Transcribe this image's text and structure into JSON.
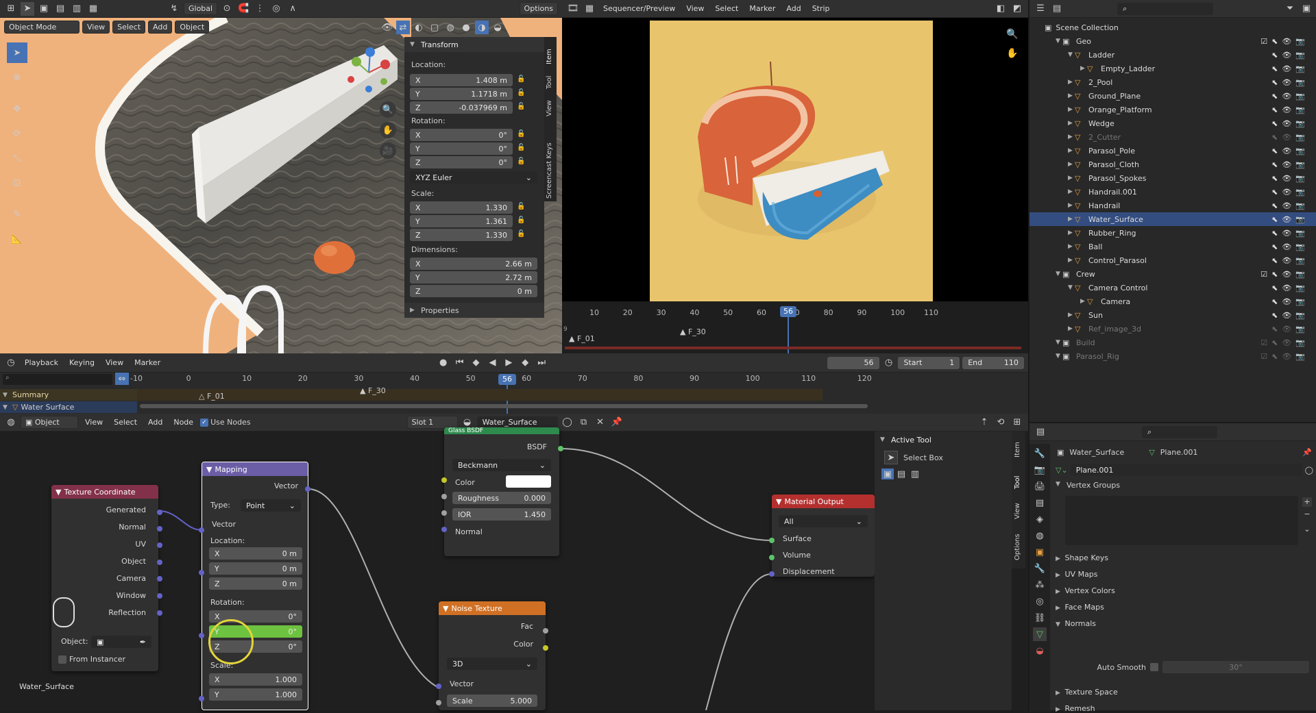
{
  "viewport": {
    "header": {
      "mode": "Object Mode",
      "menus": [
        "View",
        "Select",
        "Add",
        "Object"
      ],
      "orientation": "Global",
      "options": "Options"
    },
    "side_tabs": [
      "Item",
      "Tool",
      "View",
      "Screencast Keys"
    ],
    "transform": {
      "title": "Transform",
      "location_label": "Location:",
      "location": [
        {
          "axis": "X",
          "value": "1.408 m"
        },
        {
          "axis": "Y",
          "value": "1.1718 m"
        },
        {
          "axis": "Z",
          "value": "-0.037969 m"
        }
      ],
      "rotation_label": "Rotation:",
      "rotation": [
        {
          "axis": "X",
          "value": "0°"
        },
        {
          "axis": "Y",
          "value": "0°"
        },
        {
          "axis": "Z",
          "value": "0°"
        }
      ],
      "rotation_mode": "XYZ Euler",
      "scale_label": "Scale:",
      "scale": [
        {
          "axis": "X",
          "value": "1.330"
        },
        {
          "axis": "Y",
          "value": "1.361"
        },
        {
          "axis": "Z",
          "value": "1.330"
        }
      ],
      "dimensions_label": "Dimensions:",
      "dimensions": [
        {
          "axis": "X",
          "value": "2.66 m"
        },
        {
          "axis": "Y",
          "value": "2.72 m"
        },
        {
          "axis": "Z",
          "value": "0 m"
        }
      ],
      "properties": "Properties"
    }
  },
  "sequencer": {
    "header": {
      "mode": "Sequencer/Preview",
      "menus": [
        "View",
        "Select",
        "Marker",
        "Add",
        "Strip"
      ]
    },
    "ruler": [
      "10",
      "20",
      "30",
      "40",
      "50",
      "60",
      "70",
      "80",
      "90",
      "100",
      "110"
    ],
    "current_frame": "56",
    "markers": [
      "F_01",
      "F_30"
    ],
    "channel_num": "9"
  },
  "timeline": {
    "menus": [
      "Playback",
      "Keying",
      "View",
      "Marker"
    ],
    "frame": "56",
    "start_label": "Start",
    "start": "1",
    "end_label": "End",
    "end": "110",
    "ruler": [
      "-10",
      "0",
      "10",
      "20",
      "30",
      "40",
      "50",
      "60",
      "70",
      "80",
      "90",
      "100",
      "110",
      "120"
    ],
    "current_frame": "56",
    "summary": "Summary",
    "water_surface": "Water Surface",
    "markers": [
      "F_01",
      "F_30"
    ]
  },
  "node_editor": {
    "header": {
      "object": "Object",
      "menus": [
        "View",
        "Select",
        "Add",
        "Node"
      ],
      "use_nodes": "Use Nodes",
      "slot": "Slot 1",
      "material": "Water_Surface"
    },
    "footer_label": "Water_Surface",
    "tex_coord": {
      "title": "Texture Coordinate",
      "outputs": [
        "Generated",
        "Normal",
        "UV",
        "Object",
        "Camera",
        "Window",
        "Reflection"
      ],
      "object_label": "Object:",
      "from_instancer": "From Instancer"
    },
    "mapping": {
      "title": "Mapping",
      "vector_out": "Vector",
      "type_label": "Type:",
      "type": "Point",
      "vector_in": "Vector",
      "location_label": "Location:",
      "location": [
        {
          "axis": "X",
          "value": "0 m"
        },
        {
          "axis": "Y",
          "value": "0 m"
        },
        {
          "axis": "Z",
          "value": "0 m"
        }
      ],
      "rotation_label": "Rotation:",
      "rotation": [
        {
          "axis": "X",
          "value": "0°"
        },
        {
          "axis": "Y",
          "value": "0°"
        },
        {
          "axis": "Z",
          "value": "0°"
        }
      ],
      "scale_label": "Scale:",
      "scale": [
        {
          "axis": "X",
          "value": "1.000"
        },
        {
          "axis": "Y",
          "value": "1.000"
        }
      ]
    },
    "glass": {
      "title": "Glass BSDF",
      "bsdf": "BSDF",
      "distribution": "Beckmann",
      "color": "Color",
      "roughness_label": "Roughness",
      "roughness": "0.000",
      "ior_label": "IOR",
      "ior": "1.450",
      "normal": "Normal"
    },
    "noise": {
      "title": "Noise Texture",
      "fac": "Fac",
      "color": "Color",
      "dims": "3D",
      "vector": "Vector",
      "scale_label": "Scale",
      "scale": "5.000"
    },
    "output": {
      "title": "Material Output",
      "target": "All",
      "surface": "Surface",
      "volume": "Volume",
      "displacement": "Displacement"
    },
    "active_tool": {
      "title": "Active Tool",
      "tool": "Select Box"
    },
    "side_tabs": [
      "Item",
      "Tool",
      "View",
      "Options"
    ]
  },
  "outliner": {
    "root": "Scene Collection",
    "rows": [
      {
        "name": "Geo",
        "depth": 1,
        "dim": false
      },
      {
        "name": "Ladder",
        "depth": 2,
        "dim": false
      },
      {
        "name": "Empty_Ladder",
        "depth": 3,
        "dim": false
      },
      {
        "name": "2_Pool",
        "depth": 2,
        "dim": false
      },
      {
        "name": "Ground_Plane",
        "depth": 2,
        "dim": false
      },
      {
        "name": "Orange_Platform",
        "depth": 2,
        "dim": false
      },
      {
        "name": "Wedge",
        "depth": 2,
        "dim": false
      },
      {
        "name": "2_Cutter",
        "depth": 2,
        "dim": true
      },
      {
        "name": "Parasol_Pole",
        "depth": 2,
        "dim": false
      },
      {
        "name": "Parasol_Cloth",
        "depth": 2,
        "dim": false
      },
      {
        "name": "Parasol_Spokes",
        "depth": 2,
        "dim": false
      },
      {
        "name": "Handrail.001",
        "depth": 2,
        "dim": false
      },
      {
        "name": "Handrail",
        "depth": 2,
        "dim": false
      },
      {
        "name": "Water_Surface",
        "depth": 2,
        "dim": false,
        "selected": true
      },
      {
        "name": "Rubber_Ring",
        "depth": 2,
        "dim": false
      },
      {
        "name": "Ball",
        "depth": 2,
        "dim": false
      },
      {
        "name": "Control_Parasol",
        "depth": 2,
        "dim": false
      },
      {
        "name": "Crew",
        "depth": 1,
        "dim": false
      },
      {
        "name": "Camera Control",
        "depth": 2,
        "dim": false
      },
      {
        "name": "Camera",
        "depth": 3,
        "dim": false
      },
      {
        "name": "Sun",
        "depth": 2,
        "dim": false
      },
      {
        "name": "Ref_image_3d",
        "depth": 2,
        "dim": true
      },
      {
        "name": "Build",
        "depth": 1,
        "dim": true
      },
      {
        "name": "Parasol_Rig",
        "depth": 1,
        "dim": true
      }
    ]
  },
  "properties": {
    "object": "Water_Surface",
    "mesh": "Plane.001",
    "mesh_field": "Plane.001",
    "sections": [
      "Vertex Groups",
      "Shape Keys",
      "UV Maps",
      "Vertex Colors",
      "Face Maps",
      "Normals"
    ],
    "auto_smooth": "Auto Smooth",
    "angle": "30°",
    "more": [
      "Texture Space",
      "Remesh"
    ]
  },
  "colors": {
    "accent": "#4772b3",
    "selected_row": "#334d80",
    "current_frame": "#4772b3",
    "tex_header": "#83314a",
    "mapping_header": "#6b5ea6",
    "shader_header": "#2f8a4e",
    "noise_header": "#d07024",
    "output_header": "#b3302f",
    "green_field": "#6dc23f"
  }
}
